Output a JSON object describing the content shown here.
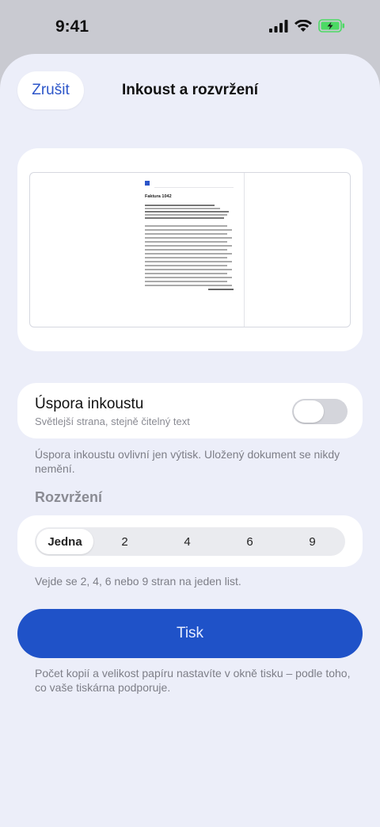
{
  "status_bar": {
    "time": "9:41"
  },
  "header": {
    "cancel_label": "Zrušit",
    "title": "Inkoust a rozvržení"
  },
  "preview": {
    "doc_title": "Faktura 1042"
  },
  "ink_saver": {
    "title": "Úspora inkoustu",
    "subtitle": "Světlejší strana, stejně čitelný text",
    "enabled": false,
    "footnote": "Úspora inkoustu ovlivní jen výtisk. Uložený dokument se nikdy nemění."
  },
  "layout": {
    "heading": "Rozvržení",
    "options": [
      "Jedna",
      "2",
      "4",
      "6",
      "9"
    ],
    "selected": "Jedna",
    "footnote": "Vejde se 2, 4, 6 nebo 9 stran na jeden list."
  },
  "print": {
    "label": "Tisk",
    "footnote": "Počet kopií a velikost papíru nastavíte v okně tisku – podle toho, co vaše tiskárna podporuje."
  },
  "colors": {
    "accent": "#1f52c8",
    "link": "#2c55c9",
    "battery": "#4cd964"
  }
}
